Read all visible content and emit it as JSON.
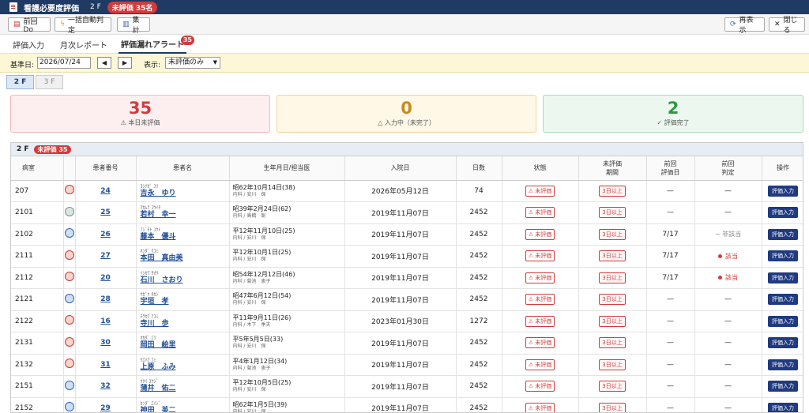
{
  "app": {
    "title": "看護必要度評価",
    "ward": "2 F",
    "unrated_badge": "未評価 35名"
  },
  "toolbar": {
    "prev_do": "前回Do",
    "auto_judge": "一括自動判定",
    "aggregate": "集計",
    "refresh": "再表示",
    "close": "閉じる"
  },
  "tabs": [
    {
      "label": "評価入力"
    },
    {
      "label": "月次レポート"
    },
    {
      "label": "評価漏れアラート",
      "badge": "35"
    }
  ],
  "filter": {
    "base_date_label": "基準日:",
    "base_date_value": "2026/07/24",
    "prev": "◀",
    "next": "▶",
    "display_label": "表示:",
    "display_value": "未評価のみ"
  },
  "ward_tabs": [
    {
      "label": "2 F"
    },
    {
      "label": "3 F"
    }
  ],
  "summary": [
    {
      "value": "35",
      "label": "⚠ 本日未評価",
      "color": "#d33b3b"
    },
    {
      "value": "0",
      "label": "△ 入力中（未完了）",
      "color": "#c98a1c"
    },
    {
      "value": "2",
      "label": "✓ 評価完了",
      "color": "#2b9a3e"
    }
  ],
  "section": {
    "title": "2 F",
    "badge": "未評価 35"
  },
  "columns": [
    "病室",
    "",
    "患者番号",
    "患者名",
    "生年月日/担当医",
    "入院日",
    "日数",
    "状態",
    "未評価\n期間",
    "前回\n評価日",
    "前回\n判定",
    "操作"
  ],
  "rows": [
    {
      "room": "207",
      "sex": "f",
      "id": "24",
      "kana": "ﾖｼﾅｶﾞ ﾕﾘ",
      "name": "吉永　ゆり",
      "dob": "昭62年10月14日(38)",
      "doc": "内科 / 安川　保",
      "adm": "2026年05月12日",
      "days": "74",
      "status": "⚠ 未評価",
      "period": "3日以上",
      "prev_date": "—",
      "prev_judge": "—",
      "judge_type": "none",
      "action": "評価入力"
    },
    {
      "room": "2101",
      "sex": "o",
      "id": "25",
      "kana": "ﾜｶﾑﾗ ｺｳｲﾁ",
      "name": "若村　幸一",
      "dob": "昭39年2月24日(62)",
      "doc": "内科 / 高橋　聡",
      "adm": "2019年11月07日",
      "days": "2452",
      "status": "⚠ 未評価",
      "period": "3日以上",
      "prev_date": "—",
      "prev_judge": "—",
      "judge_type": "none",
      "action": "評価入力"
    },
    {
      "room": "2102",
      "sex": "m",
      "id": "26",
      "kana": "ﾌｼﾞﾓﾄ ﾕｳﾄ",
      "name": "藤本　優斗",
      "dob": "平12年11月10日(25)",
      "doc": "内科 / 安川　保",
      "adm": "2019年11月07日",
      "days": "2452",
      "status": "⚠ 未評価",
      "period": "3日以上",
      "prev_date": "7/17",
      "prev_judge": "− 非該当",
      "judge_type": "na",
      "action": "評価入力"
    },
    {
      "room": "2111",
      "sex": "f",
      "id": "27",
      "kana": "ﾎﾝﾀﾞ ﾏﾕﾐ",
      "name": "本田　真由美",
      "dob": "平12年10月1日(25)",
      "doc": "内科 / 安川　保",
      "adm": "2019年11月07日",
      "days": "2452",
      "status": "⚠ 未評価",
      "period": "3日以上",
      "prev_date": "7/17",
      "prev_judge": "該当",
      "judge_type": "yes",
      "action": "評価入力"
    },
    {
      "room": "2112",
      "sex": "f",
      "id": "20",
      "kana": "ｲｼｶﾜ ｻｵﾘ",
      "name": "石川　さおり",
      "dob": "昭54年12月12日(46)",
      "doc": "内科 / 菊池　恵子",
      "adm": "2019年11月07日",
      "days": "2452",
      "status": "⚠ 未評価",
      "period": "3日以上",
      "prev_date": "7/17",
      "prev_judge": "該当",
      "judge_type": "yes",
      "action": "評価入力"
    },
    {
      "room": "2121",
      "sex": "m",
      "id": "28",
      "kana": "ｳｶﾞｷ ﾀｶｼ",
      "name": "宇垣　孝",
      "dob": "昭47年6月12日(54)",
      "doc": "内科 / 安川　保",
      "adm": "2019年11月07日",
      "days": "2452",
      "status": "⚠ 未評価",
      "period": "3日以上",
      "prev_date": "—",
      "prev_judge": "—",
      "judge_type": "none",
      "action": "評価入力"
    },
    {
      "room": "2122",
      "sex": "f",
      "id": "16",
      "kana": "ﾃﾗｶﾜ ｱﾕﾐ",
      "name": "寺川　歩",
      "dob": "平11年9月11日(26)",
      "doc": "内科 / 木下　季夫",
      "adm": "2023年01月30日",
      "days": "1272",
      "status": "⚠ 未評価",
      "period": "3日以上",
      "prev_date": "—",
      "prev_judge": "—",
      "judge_type": "none",
      "action": "評価入力"
    },
    {
      "room": "2131",
      "sex": "f",
      "id": "30",
      "kana": "ｵｶﾀﾞ ｴﾘ",
      "name": "岡田　絵里",
      "dob": "平5年5月5日(33)",
      "doc": "内科 / 安川　保",
      "adm": "2019年11月07日",
      "days": "2452",
      "status": "⚠ 未評価",
      "period": "3日以上",
      "prev_date": "—",
      "prev_judge": "—",
      "judge_type": "none",
      "action": "評価入力"
    },
    {
      "room": "2132",
      "sex": "f",
      "id": "31",
      "kana": "ｳｴﾊﾗ ﾌﾐ",
      "name": "上原　ふみ",
      "dob": "平4年1月12日(34)",
      "doc": "内科 / 菊池　恵子",
      "adm": "2019年11月07日",
      "days": "2452",
      "status": "⚠ 未評価",
      "period": "3日以上",
      "prev_date": "—",
      "prev_judge": "—",
      "judge_type": "none",
      "action": "評価入力"
    },
    {
      "room": "2151",
      "sex": "m",
      "id": "32",
      "kana": "ｳｸｲ ﾕｳｼﾞ",
      "name": "蒲井　佑二",
      "dob": "平12年10月5日(25)",
      "doc": "内科 / 安川　保",
      "adm": "2019年11月07日",
      "days": "2452",
      "status": "⚠ 未評価",
      "period": "3日以上",
      "prev_date": "—",
      "prev_judge": "—",
      "judge_type": "none",
      "action": "評価入力"
    },
    {
      "room": "2152",
      "sex": "m",
      "id": "29",
      "kana": "ｶﾝﾀﾞ ｴｲｼﾞ",
      "name": "神田　英二",
      "dob": "昭62年1月5日(39)",
      "doc": "内科 / 安川　保",
      "adm": "2019年11月07日",
      "days": "2452",
      "status": "⚠ 未評価",
      "period": "3日以上",
      "prev_date": "—",
      "prev_judge": "—",
      "judge_type": "none",
      "action": "評価入力"
    }
  ]
}
